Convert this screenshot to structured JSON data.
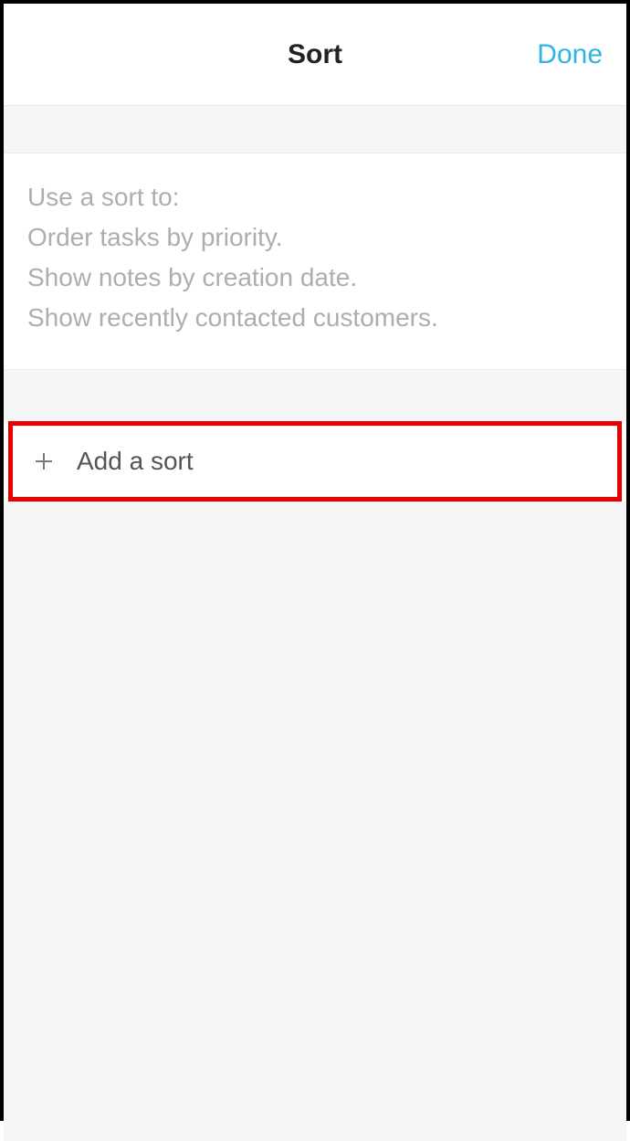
{
  "header": {
    "title": "Sort",
    "done_label": "Done"
  },
  "description": {
    "intro": "Use a sort to:",
    "example1": "Order tasks by priority.",
    "example2": "Show notes by creation date.",
    "example3": "Show recently contacted customers."
  },
  "add_sort": {
    "label": "Add a sort"
  },
  "colors": {
    "accent": "#2eb4e6",
    "highlight_border": "#e60000",
    "muted_text": "#aeaeae",
    "background_alt": "#f6f6f6"
  }
}
